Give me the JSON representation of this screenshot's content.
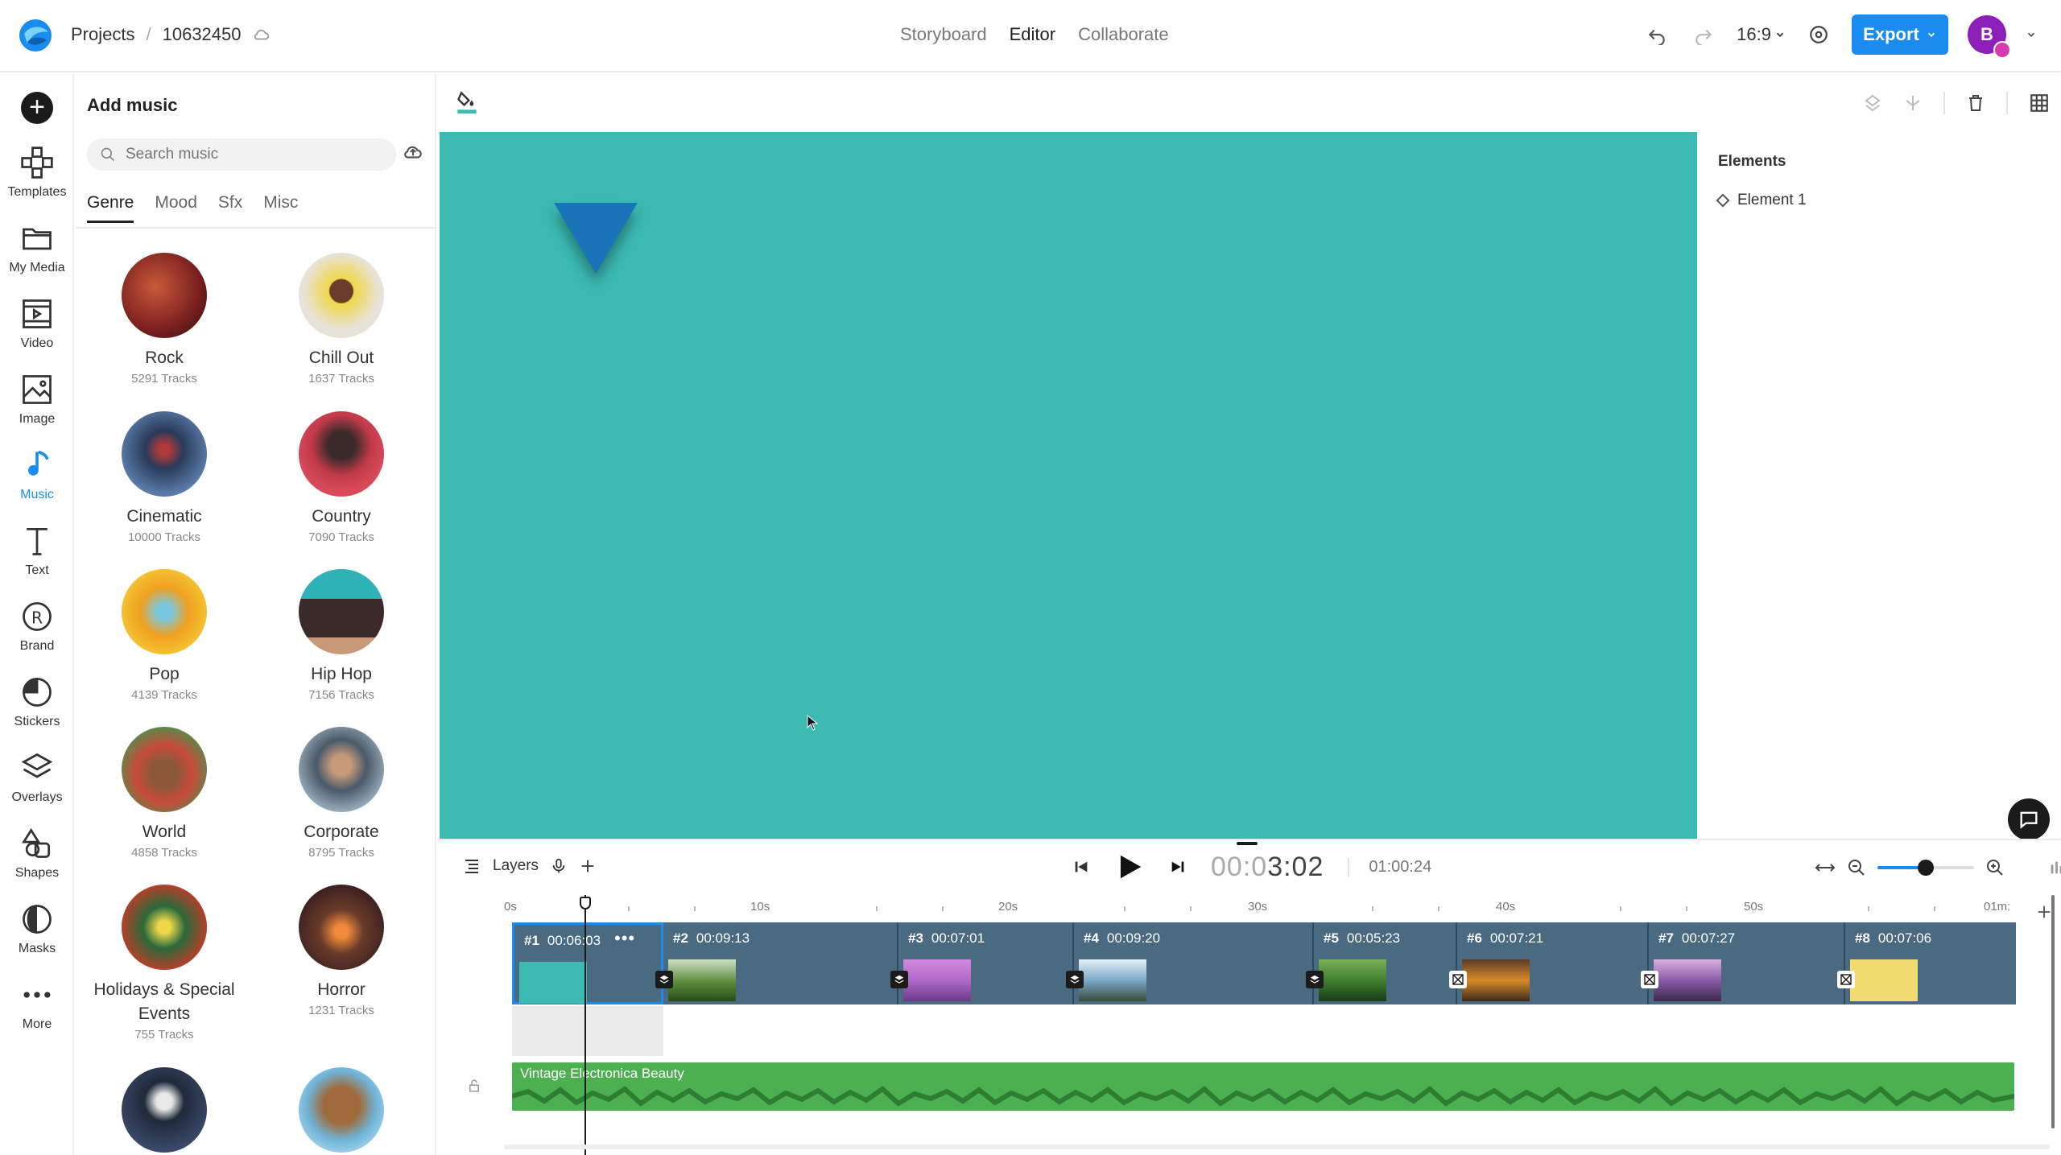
{
  "header": {
    "breadcrumb_root": "Projects",
    "breadcrumb_sep": "/",
    "project_id": "10632450",
    "modes": [
      "Storyboard",
      "Editor",
      "Collaborate"
    ],
    "active_mode": "Editor",
    "ratio": "16:9",
    "export_label": "Export",
    "avatar_initial": "B"
  },
  "rail": [
    {
      "label": "Templates",
      "icon": "templates-icon"
    },
    {
      "label": "My Media",
      "icon": "folder-icon"
    },
    {
      "label": "Video",
      "icon": "video-icon"
    },
    {
      "label": "Image",
      "icon": "image-icon"
    },
    {
      "label": "Music",
      "icon": "music-icon"
    },
    {
      "label": "Text",
      "icon": "text-icon"
    },
    {
      "label": "Brand",
      "icon": "brand-icon"
    },
    {
      "label": "Stickers",
      "icon": "sticker-icon"
    },
    {
      "label": "Overlays",
      "icon": "overlays-icon"
    },
    {
      "label": "Shapes",
      "icon": "shapes-icon"
    },
    {
      "label": "Masks",
      "icon": "masks-icon"
    },
    {
      "label": "More",
      "icon": "more-icon"
    }
  ],
  "music_panel": {
    "title": "Add music",
    "search_placeholder": "Search music",
    "tabs": [
      "Genre",
      "Mood",
      "Sfx",
      "Misc"
    ],
    "active_tab": "Genre",
    "genres": [
      {
        "name": "Rock",
        "count": "5291 Tracks",
        "color": "#7a1f1f"
      },
      {
        "name": "Chill Out",
        "count": "1637 Tracks",
        "color": "#e8c24a"
      },
      {
        "name": "Cinematic",
        "count": "10000 Tracks",
        "color": "#3a5a80"
      },
      {
        "name": "Country",
        "count": "7090 Tracks",
        "color": "#c23a4a"
      },
      {
        "name": "Pop",
        "count": "4139 Tracks",
        "color": "#f0a020"
      },
      {
        "name": "Hip Hop",
        "count": "7156 Tracks",
        "color": "#2fb3b8"
      },
      {
        "name": "World",
        "count": "4858 Tracks",
        "color": "#9a3a2a"
      },
      {
        "name": "Corporate",
        "count": "8795 Tracks",
        "color": "#4a5a6a"
      },
      {
        "name": "Holidays & Special Events",
        "count": "755 Tracks",
        "color": "#b0402a"
      },
      {
        "name": "Horror",
        "count": "1231 Tracks",
        "color": "#6a3a2a"
      },
      {
        "name": "",
        "count": "",
        "color": "#1f2a3a"
      },
      {
        "name": "",
        "count": "",
        "color": "#6fb4d8"
      }
    ]
  },
  "elements_panel": {
    "title": "Elements",
    "items": [
      "Element 1"
    ]
  },
  "timeline": {
    "layers_label": "Layers",
    "timecode_dim": "00:0",
    "timecode_bright": "3:02",
    "total": "01:00:24",
    "zoom_level": 0.5,
    "ruler": [
      "0s",
      "10s",
      "20s",
      "30s",
      "40s",
      "50s",
      "01m:"
    ],
    "scenes": [
      {
        "num": "#1",
        "dur": "00:06:03",
        "color": "#3cbab2"
      },
      {
        "num": "#2",
        "dur": "00:09:13",
        "color": "#5a8a3a"
      },
      {
        "num": "#3",
        "dur": "00:07:01",
        "color": "#b06ac8"
      },
      {
        "num": "#4",
        "dur": "00:09:20",
        "color": "#7aa8c8"
      },
      {
        "num": "#5",
        "dur": "00:05:23",
        "color": "#3a7a2a"
      },
      {
        "num": "#6",
        "dur": "00:07:21",
        "color": "#d88a2a"
      },
      {
        "num": "#7",
        "dur": "00:07:27",
        "color": "#8a5aa8"
      },
      {
        "num": "#8",
        "dur": "00:07:06",
        "color": "#f0dc70"
      }
    ],
    "audio_track": "Vintage Electronica Beauty"
  },
  "colors": {
    "canvas": "#3cbab2",
    "accent": "#1a8cf0",
    "shape": "#1a75b8",
    "audio": "#4caf50"
  }
}
